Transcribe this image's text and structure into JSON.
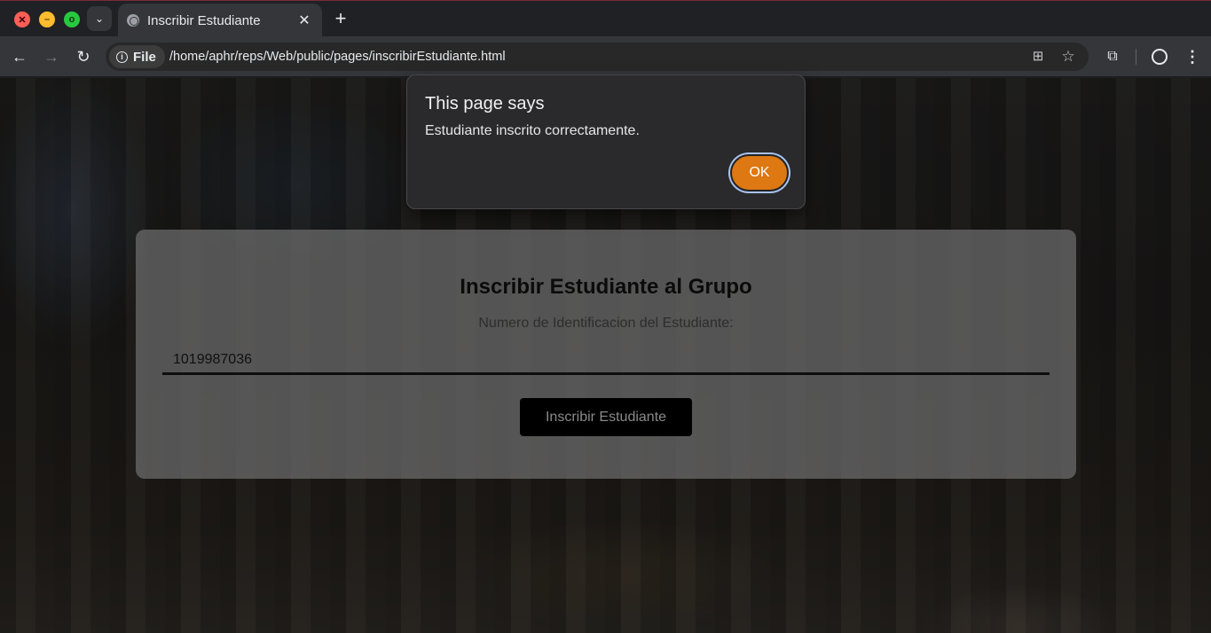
{
  "browser": {
    "tab": {
      "title": "Inscribir Estudiante",
      "close_glyph": "✕"
    },
    "window_controls": {
      "close": "✕",
      "minimize": "–",
      "maximize": "o"
    },
    "tab_search_glyph": "⌄",
    "new_tab_glyph": "+",
    "site_chip_label": "File",
    "url": "/home/aphr/reps/Web/public/pages/inscribirEstudiante.html",
    "icons": {
      "back": "←",
      "forward": "→",
      "reload": "↻",
      "info": "i",
      "translate": "⊞",
      "star": "☆",
      "extensions": "⧉",
      "menu": "⋮"
    }
  },
  "page": {
    "title": "Inscribir Estudiante al Grupo",
    "id_label": "Numero de Identificacion del Estudiante:",
    "id_value": "1019987036",
    "submit_label": "Inscribir Estudiante"
  },
  "dialog": {
    "title": "This page says",
    "message": "Estudiante inscrito correctamente.",
    "ok_label": "OK"
  },
  "colors": {
    "ok_button": "#dd7812",
    "dialog_bg": "#2a2a2d",
    "toolbar_bg": "#35363a"
  }
}
